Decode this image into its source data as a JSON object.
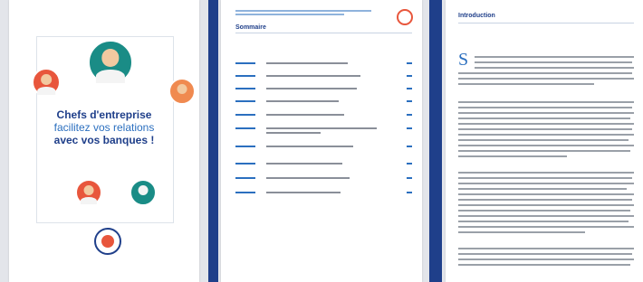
{
  "cover": {
    "title_line1": "Chefs d'entreprise",
    "title_line2": "facilitez vos relations",
    "title_line3": "avec vos banques !"
  },
  "summary": {
    "title": "Sommaire",
    "entries_shown": 11
  },
  "introduction": {
    "title": "Introduction",
    "dropcap": "S"
  },
  "colors": {
    "navy": "#1f3f8a",
    "blue": "#2b6fbf",
    "teal": "#1a8c86",
    "orange": "#e8563c"
  }
}
